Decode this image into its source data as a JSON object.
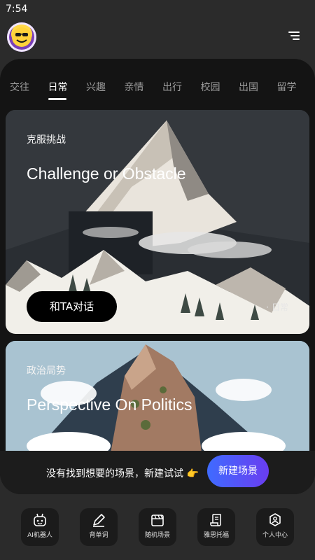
{
  "status_bar": {
    "time": "7:54"
  },
  "header": {
    "avatar_icon": "smiley-avatar-icon",
    "menu_icon": "menu-icon"
  },
  "tabs": [
    {
      "label": "交往",
      "active": false
    },
    {
      "label": "日常",
      "active": true
    },
    {
      "label": "兴趣",
      "active": false
    },
    {
      "label": "亲情",
      "active": false
    },
    {
      "label": "出行",
      "active": false
    },
    {
      "label": "校园",
      "active": false
    },
    {
      "label": "出国",
      "active": false
    },
    {
      "label": "留学",
      "active": false
    }
  ],
  "cards": [
    {
      "subtitle": "克服挑战",
      "title": "Challenge or Obstacle",
      "button_label": "和TA对话",
      "tag": "· 日常"
    },
    {
      "subtitle": "政治局势",
      "title": "Perspective On Politics"
    }
  ],
  "banner": {
    "text": "没有找到想要的场景，新建试试 👉",
    "button_label": "新建场景"
  },
  "bottom_nav": [
    {
      "label": "AI机器人",
      "icon": "robot-icon"
    },
    {
      "label": "背单词",
      "icon": "pen-icon"
    },
    {
      "label": "随机场景",
      "icon": "film-icon"
    },
    {
      "label": "雅思托福",
      "icon": "scroll-icon"
    },
    {
      "label": "个人中心",
      "icon": "user-gear-icon"
    }
  ]
}
